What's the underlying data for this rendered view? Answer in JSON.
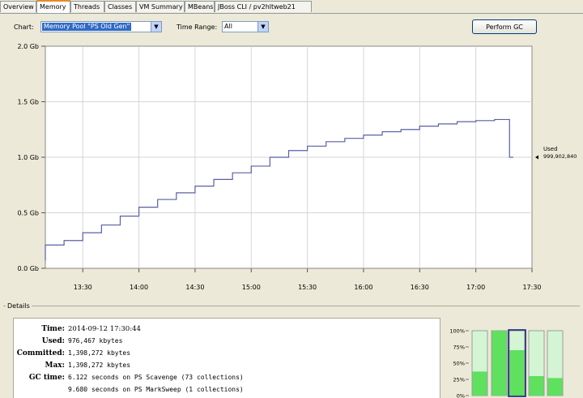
{
  "tabs": [
    {
      "label": "Overview",
      "active": false
    },
    {
      "label": "Memory",
      "active": true
    },
    {
      "label": "Threads",
      "active": false
    },
    {
      "label": "Classes",
      "active": false
    },
    {
      "label": "VM Summary",
      "active": false
    },
    {
      "label": "MBeans",
      "active": false
    },
    {
      "label": "JBoss CLI / pv2hltweb21",
      "active": false
    }
  ],
  "toolbar": {
    "chart_label": "Chart:",
    "chart_value": "Memory Pool \"PS Old Gen\"",
    "time_range_label": "Time Range:",
    "time_range_value": "All",
    "gc_button": "Perform GC"
  },
  "chart_data": {
    "type": "line",
    "title": "",
    "xlabel": "",
    "ylabel": "",
    "y_ticks": [
      "0.0 Gb",
      "0.5 Gb",
      "1.0 Gb",
      "1.5 Gb",
      "2.0 Gb"
    ],
    "y_tick_values": [
      0,
      0.5,
      1.0,
      1.5,
      2.0
    ],
    "x_ticks": [
      "13:30",
      "14:00",
      "14:30",
      "15:00",
      "15:30",
      "16:00",
      "16:30",
      "17:00",
      "17:30"
    ],
    "x_tick_values": [
      "13:30",
      "14:00",
      "14:30",
      "15:00",
      "15:30",
      "16:00",
      "16:30",
      "17:00",
      "17:30"
    ],
    "xlim": [
      "13:10",
      "17:30"
    ],
    "ylim": [
      0,
      2.0
    ],
    "grid": true,
    "line_color": "#5b5fa8",
    "series": [
      {
        "name": "Used",
        "x": [
          "13:10",
          "13:10",
          "13:20",
          "13:30",
          "13:40",
          "13:50",
          "14:00",
          "14:10",
          "14:20",
          "14:30",
          "14:40",
          "14:50",
          "15:00",
          "15:10",
          "15:20",
          "15:30",
          "15:40",
          "15:50",
          "16:00",
          "16:10",
          "16:20",
          "16:30",
          "16:40",
          "16:50",
          "17:00",
          "17:10",
          "17:18",
          "17:18",
          "17:20"
        ],
        "y": [
          0.07,
          0.21,
          0.25,
          0.32,
          0.39,
          0.47,
          0.55,
          0.62,
          0.68,
          0.74,
          0.8,
          0.86,
          0.92,
          1.0,
          1.06,
          1.1,
          1.14,
          1.17,
          1.2,
          1.23,
          1.25,
          1.28,
          1.3,
          1.32,
          1.33,
          1.34,
          1.34,
          1.0,
          1.0
        ]
      }
    ],
    "current_label": "Used",
    "current_value": "999,902,840"
  },
  "details": {
    "title": "Details",
    "rows": [
      {
        "key": "Time:",
        "value": "2014-09-12 17:30:44",
        "serif": true
      },
      {
        "key": "Used:",
        "value": "976,467 kbytes",
        "serif": false
      },
      {
        "key": "Committed:",
        "value": "1,398,272 kbytes",
        "serif": false
      },
      {
        "key": "Max:",
        "value": "1,398,272 kbytes",
        "serif": false
      },
      {
        "key": "GC time:",
        "value": "6.122 seconds on PS Scavenge (73 collections)",
        "serif": false
      },
      {
        "key": "",
        "value": "9.680 seconds on PS MarkSweep (1 collections)",
        "serif": false
      }
    ]
  },
  "pool_bars": {
    "ticks": [
      "100%",
      "75%",
      "50%",
      "25%",
      "0%"
    ],
    "tick_values": [
      100,
      75,
      50,
      25,
      0
    ],
    "fills": [
      37,
      100,
      70,
      30,
      27
    ],
    "selected": 2,
    "fill_color": "#5fe05f",
    "empty_color": "#d3f5d3"
  }
}
